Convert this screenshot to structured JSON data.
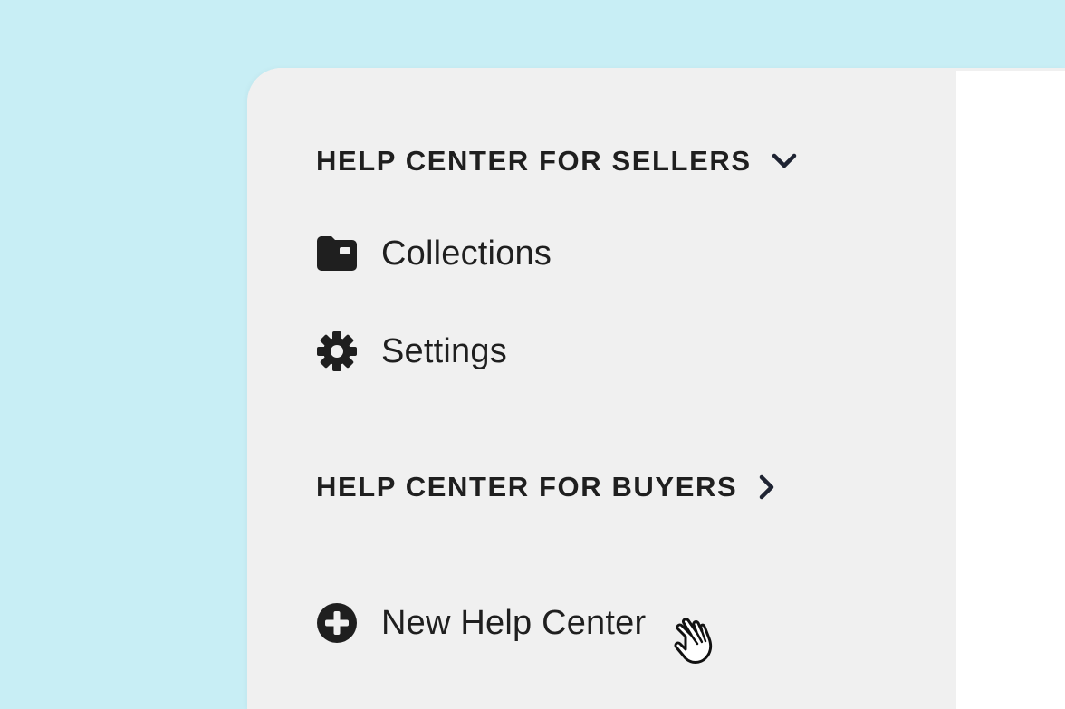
{
  "sidebar": {
    "sections": [
      {
        "title": "HELP CENTER FOR SELLERS",
        "state": "expanded",
        "chevron_icon": "chevron-down-icon",
        "items": [
          {
            "label": "Collections",
            "icon": "folder-icon"
          },
          {
            "label": "Settings",
            "icon": "gear-icon"
          }
        ]
      },
      {
        "title": "HELP CENTER FOR BUYERS",
        "state": "collapsed",
        "chevron_icon": "chevron-right-icon"
      }
    ],
    "new_item": {
      "label": "New Help Center",
      "icon": "plus-circle-icon"
    }
  },
  "cursor": {
    "icon": "pointing-hand-cursor"
  },
  "colors": {
    "backdrop": "#c8eef5",
    "sidebar_bg": "#f0f0f0",
    "main_bg": "#ffffff",
    "text": "#1f1f1f"
  }
}
